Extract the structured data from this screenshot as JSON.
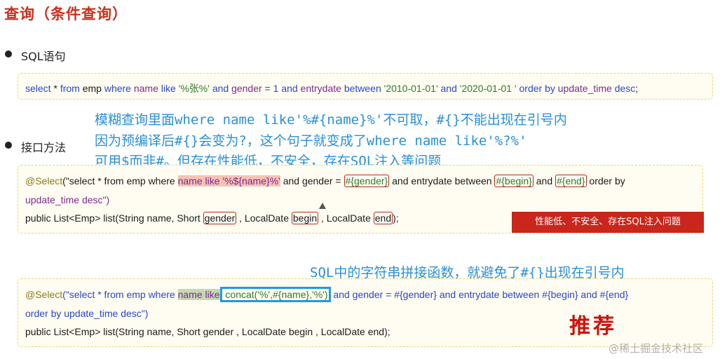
{
  "title": "查询（条件查询）",
  "sections": {
    "sql": {
      "label": "SQL语句"
    },
    "api": {
      "label": "接口方法"
    }
  },
  "sql_statement": {
    "p1": "select",
    "p2": " * ",
    "p3": "from",
    "p4": " emp ",
    "p5": "where",
    "p6": " name ",
    "p7": "like",
    "p8": " '%张%' ",
    "p9": "and",
    "p10": " gender ",
    "p11": "= 1 ",
    "p12": "and",
    "p13": " entrydate ",
    "p14": "between",
    "p15": " '2010-01-01' ",
    "p16": "and",
    "p17": " '2020-01-01 ' ",
    "p18": "order by",
    "p19": " update_time ",
    "p20": "desc",
    "p21": ";"
  },
  "notes": {
    "line1": "模糊查询里面where name like'%#{name}%'不可取，#{}不能出现在引号内",
    "line2": "因为预编译后#{}会变为?，这个句子就变成了where name like'%?%'",
    "line3": "可用$而非#。但存在性能低，不安全，存在SQL注入等问题",
    "concat": "SQL中的字符串拼接函数，就避免了#{}出现在引号内"
  },
  "method1": {
    "ann": "@Select",
    "l1a": "(\"select * from emp where ",
    "l1b": "name like '%${name}%'",
    "l1c": " and gender = ",
    "l1d": "#{gender}",
    "l1e": " and entrydate between ",
    "l1f": "#{begin}",
    "l1g": " and ",
    "l1h": "#{end}",
    "l1i": " order by",
    "l2": "update_time desc\")",
    "l3a": "public List<Emp> list(String name, Short ",
    "l3b": "gender",
    "l3c": " , LocalDate ",
    "l3d": "begin",
    "l3e": " , LocalDate ",
    "l3f": "end",
    "l3g": ");",
    "badge": "性能低、不安全、存在SQL注入问题"
  },
  "method2": {
    "ann": "@Select",
    "l1a": "(\"select * from emp where ",
    "l1b": "name like",
    "l1c": " concat('%',#{name},'%')",
    "l1d": " and gender = #{gender} and entrydate between #{begin} and #{end}",
    "l2": "order by update_time desc\")",
    "l3": "public List<Emp> list(String name, Short gender , LocalDate begin , LocalDate end);"
  },
  "recommend": "推荐",
  "watermark": "@稀土掘金技术社区"
}
